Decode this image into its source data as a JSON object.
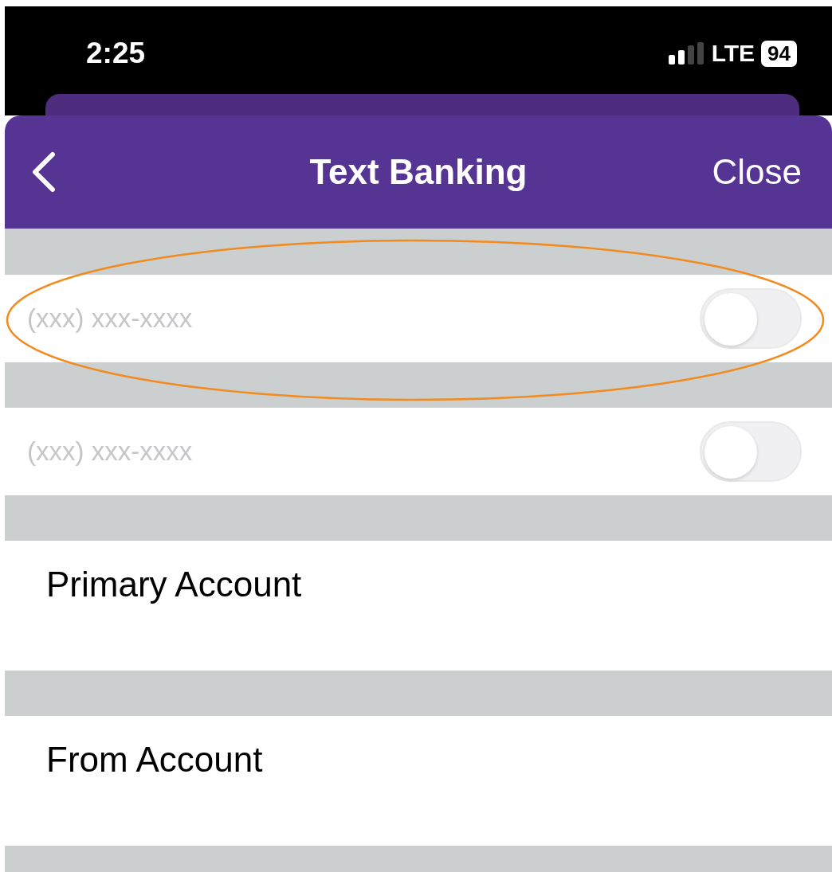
{
  "status_bar": {
    "time": "2:25",
    "network": "LTE",
    "battery": "94"
  },
  "nav": {
    "title": "Text Banking",
    "close": "Close"
  },
  "phone_fields": [
    {
      "placeholder": "(xxx) xxx-xxxx",
      "on": false
    },
    {
      "placeholder": "(xxx) xxx-xxxx",
      "on": false
    }
  ],
  "rows": [
    {
      "label": "Primary Account"
    },
    {
      "label": "From Account"
    }
  ]
}
